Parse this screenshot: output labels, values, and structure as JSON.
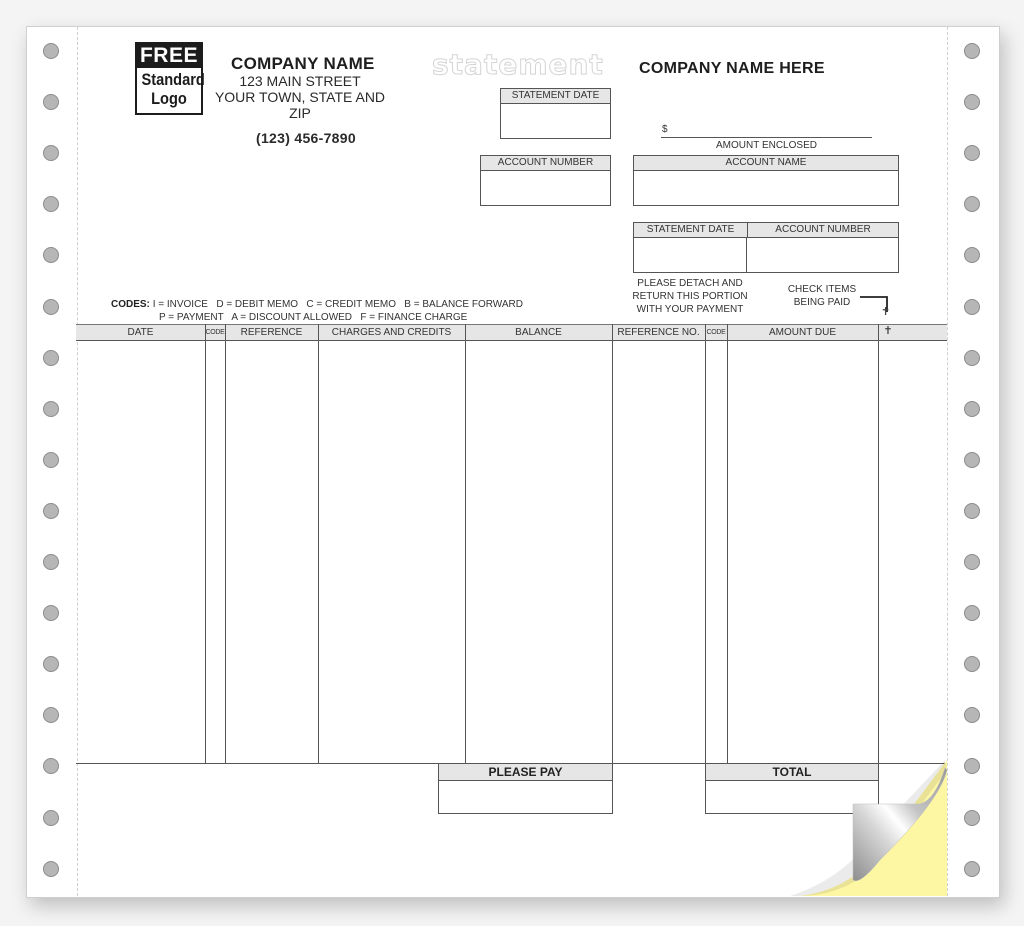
{
  "logo": {
    "top": "FREE",
    "line1": "Standard",
    "line2": "Logo"
  },
  "company": {
    "name": "COMPANY NAME",
    "street": "123 MAIN STREET",
    "city": "YOUR TOWN, STATE AND ZIP",
    "phone": "(123) 456-7890"
  },
  "watermark": "statement",
  "stub_company": "COMPANY NAME HERE",
  "fields": {
    "statement_date": "STATEMENT DATE",
    "account_number": "ACCOUNT NUMBER",
    "account_name": "ACCOUNT NAME",
    "dollar_sign": "$",
    "amount_enclosed": "AMOUNT ENCLOSED"
  },
  "stub_fields": {
    "statement_date": "STATEMENT DATE",
    "account_number": "ACCOUNT NUMBER"
  },
  "detach_note": [
    "PLEASE DETACH AND",
    "RETURN THIS PORTION",
    "WITH YOUR PAYMENT"
  ],
  "check_items_note": [
    "CHECK ITEMS",
    "BEING PAID"
  ],
  "check_mark_symbol": "✝",
  "codes": {
    "label": "CODES:",
    "line1": "I = INVOICE   D = DEBIT MEMO   C = CREDIT MEMO   B = BALANCE FORWARD",
    "line2": "P = PAYMENT   A = DISCOUNT ALLOWED   F = FINANCE CHARGE"
  },
  "table": {
    "columns": [
      "DATE",
      "CODE",
      "REFERENCE",
      "CHARGES AND CREDITS",
      "BALANCE",
      "REFERENCE NO.",
      "CODE",
      "AMOUNT DUE",
      "✝"
    ],
    "rows": []
  },
  "summary": {
    "please_pay": "PLEASE PAY",
    "total": "TOTAL"
  },
  "colors": {
    "header_fill": "#e6e6e6",
    "carbon_copy": "#fdf6a3",
    "hole": "#b6b6b6"
  }
}
